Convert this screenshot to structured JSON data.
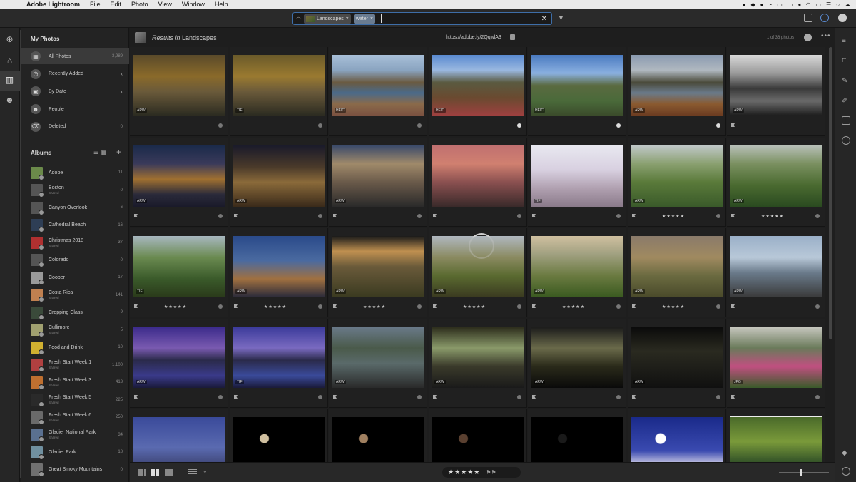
{
  "menubar": {
    "app": "Adobe Lightroom",
    "items": [
      "File",
      "Edit",
      "Photo",
      "View",
      "Window",
      "Help"
    ]
  },
  "search": {
    "chip_album": "Landscapes",
    "chip_keyword": "water"
  },
  "left_panel": {
    "my_photos_title": "My Photos",
    "nav": [
      {
        "label": "All Photos",
        "count": "3,989",
        "icon": "grid-icon"
      },
      {
        "label": "Recently Added",
        "count": "",
        "icon": "clock-icon"
      },
      {
        "label": "By Date",
        "count": "",
        "icon": "calendar-icon"
      },
      {
        "label": "People",
        "count": "",
        "icon": "person-icon"
      },
      {
        "label": "Deleted",
        "count": "0",
        "icon": "trash-icon"
      }
    ],
    "albums_title": "Albums",
    "albums": [
      {
        "name": "Adobe",
        "sub": "",
        "count": "11",
        "color": "#6b8a4a"
      },
      {
        "name": "Boston",
        "sub": "Shared",
        "count": "0",
        "color": "#555555"
      },
      {
        "name": "Canyon Overlook",
        "sub": "",
        "count": "6",
        "color": "#555555"
      },
      {
        "name": "Cathedral Beach",
        "sub": "",
        "count": "16",
        "color": "#2e3e55"
      },
      {
        "name": "Christmas 2018",
        "sub": "Shared",
        "count": "37",
        "color": "#b03030"
      },
      {
        "name": "Colorado",
        "sub": "",
        "count": "0",
        "color": "#555555"
      },
      {
        "name": "Cooper",
        "sub": "",
        "count": "17",
        "color": "#9a9a9a"
      },
      {
        "name": "Costa Rica",
        "sub": "Shared",
        "count": "141",
        "color": "#c08050"
      },
      {
        "name": "Cropping Class",
        "sub": "",
        "count": "9",
        "color": "#3a4a3a"
      },
      {
        "name": "Cullimore",
        "sub": "Shared",
        "count": "5",
        "color": "#a0a070"
      },
      {
        "name": "Food and Drink",
        "sub": "",
        "count": "10",
        "color": "#d0b030"
      },
      {
        "name": "Fresh Start Week 1",
        "sub": "Shared",
        "count": "1,100",
        "color": "#b04040"
      },
      {
        "name": "Fresh Start Week 3",
        "sub": "Shared",
        "count": "413",
        "color": "#c07030"
      },
      {
        "name": "Fresh Start Week 5",
        "sub": "Shared",
        "count": "225",
        "color": "#2a2a2a"
      },
      {
        "name": "Fresh Start Week 6",
        "sub": "Shared",
        "count": "250",
        "color": "#6a6a6a"
      },
      {
        "name": "Glacier National Park",
        "sub": "Shared",
        "count": "34",
        "color": "#5a7090"
      },
      {
        "name": "Glacier Park",
        "sub": "",
        "count": "18",
        "color": "#7090a0"
      },
      {
        "name": "Great Smoky Mountains",
        "sub": "",
        "count": "0",
        "color": "#707070"
      }
    ]
  },
  "header": {
    "results_prefix": "Results in",
    "results_album": "Landscapes",
    "share_link": "https://adobe.ly/2QqwlA3",
    "photo_count": "1 of 36 photos"
  },
  "grid": {
    "photos": [
      {
        "badge": "ARW",
        "stars": "",
        "status": "dot",
        "flag": false,
        "bg": "linear-gradient(180deg,#5a4a2a 0%,#8a6a2a 35%,#6a5a3a 60%,#2a2a20 100%)"
      },
      {
        "badge": "TIF",
        "stars": "",
        "status": "dot",
        "flag": false,
        "bg": "linear-gradient(180deg,#6a5a2a 0%,#9a7a30 35%,#6a5a3a 60%,#2a2a20 100%)"
      },
      {
        "badge": "HEIC",
        "stars": "",
        "status": "dot",
        "flag": false,
        "bg": "linear-gradient(180deg,#a8bfd8 0%,#8aa4c0 25%,#6a5a40 45%,#4a6a8a 62%,#8a6a4a 80%,#7a5040 100%)"
      },
      {
        "badge": "HEIC",
        "stars": "",
        "status": "check",
        "flag": false,
        "bg": "linear-gradient(180deg,#5a8ad0 0%,#9ab8e0 25%,#5a5a40 45%,#6a4a30 70%,#a04040 100%)"
      },
      {
        "badge": "HEIC",
        "stars": "",
        "status": "check",
        "flag": false,
        "bg": "linear-gradient(180deg,#4a7ac0 0%,#8ab0e0 30%,#5a6a40 50%,#4a6a3a 75%,#3a4a2a 100%)"
      },
      {
        "badge": "ARW",
        "stars": "",
        "status": "check",
        "flag": false,
        "bg": "linear-gradient(180deg,#8a9ab0 0%,#b0b8c0 25%,#4a4a3a 45%,#6a7a8a 62%,#8a5a30 80%,#6a3a20 100%)"
      },
      {
        "badge": "ARW",
        "stars": "",
        "status": "",
        "flag": true,
        "bg": "linear-gradient(180deg,#d8d8d8 0%,#9a9a9a 30%,#3a3a3a 55%,#6a6a6a 75%,#1a1a1a 100%)"
      },
      {
        "badge": "ARW",
        "stars": "",
        "status": "dot",
        "flag": true,
        "bg": "linear-gradient(180deg,#1a2a4a 0%,#3a3a5a 30%,#a07030 55%,#2a2a3a 80%,#1a1a2a 100%)"
      },
      {
        "badge": "ARW",
        "stars": "",
        "status": "dot",
        "flag": true,
        "bg": "linear-gradient(180deg,#1a1a2a 0%,#4a3a2a 35%,#8a6a3a 60%,#3a2a1a 100%)"
      },
      {
        "badge": "ARW",
        "stars": "",
        "status": "dot",
        "flag": true,
        "bg": "linear-gradient(180deg,#3a4a6a 0%,#a08a6a 30%,#6a5a4a 60%,#2a2a2a 100%)"
      },
      {
        "badge": "",
        "stars": "",
        "status": "dot",
        "flag": true,
        "bg": "linear-gradient(180deg,#c07070 0%,#d08070 30%,#8a5050 60%,#3a2a2a 100%)"
      },
      {
        "badge": "TIF",
        "stars": "",
        "status": "dot",
        "flag": true,
        "bg": "linear-gradient(180deg,#e8e8f0 0%,#d8d0e0 40%,#b0a0b0 70%,#8a7a8a 100%)"
      },
      {
        "badge": "ARW",
        "stars": "★★★★★",
        "status": "dot",
        "flag": true,
        "bg": "linear-gradient(180deg,#c0c8c8 0%,#8aa070 30%,#5a7a3a 60%,#3a5a2a 100%)"
      },
      {
        "badge": "ARW",
        "stars": "★★★★★",
        "status": "dot",
        "flag": true,
        "bg": "linear-gradient(180deg,#b8c0b8 0%,#7a9060 30%,#4a6a30 65%,#2a4a20 100%)"
      },
      {
        "badge": "TIF",
        "stars": "★★★★★",
        "status": "dot",
        "flag": true,
        "bg": "linear-gradient(180deg,#a8b8c0 0%,#6a8a50 35%,#3a5a2a 70%,#2a3a1a 100%)"
      },
      {
        "badge": "ARW",
        "stars": "★★★★★",
        "status": "dot",
        "flag": true,
        "bg": "linear-gradient(180deg,#2a4a8a 0%,#4a6aa0 40%,#a07040 70%,#2a2a3a 100%)"
      },
      {
        "badge": "ARW",
        "stars": "★★★★★",
        "status": "dot",
        "flag": true,
        "bg": "linear-gradient(180deg,#1a1a1a 0%,#c09050 25%,#6a5a3a 50%,#3a3a20 100%)"
      },
      {
        "badge": "ARW",
        "stars": "★★★★★",
        "status": "dot",
        "flag": true,
        "bg": "linear-gradient(180deg,#b0b8c0 0%,#8a8a60 35%,#5a6a30 65%,#3a3a20 100%)"
      },
      {
        "badge": "ARW",
        "stars": "★★★★★",
        "status": "dot",
        "flag": true,
        "bg": "linear-gradient(180deg,#d0c0a0 0%,#a0a080 30%,#6a7a40 65%,#3a5a20 100%)"
      },
      {
        "badge": "ARW",
        "stars": "★★★★★",
        "status": "dot",
        "flag": true,
        "bg": "linear-gradient(180deg,#8a7a6a 0%,#a08a60 35%,#6a6a40 65%,#4a4a2a 100%)"
      },
      {
        "badge": "ARW",
        "stars": "",
        "status": "dot",
        "flag": true,
        "bg": "linear-gradient(180deg,#9ab0c8 0%,#b8c8d8 35%,#6a7a8a 60%,#3a3a3a 100%)"
      },
      {
        "badge": "ARW",
        "stars": "",
        "status": "dot",
        "flag": true,
        "bg": "linear-gradient(180deg,#3a2a8a 0%,#7a5ab0 35%,#2a2a4a 55%,#3a3a8a 80%,#1a1a3a 100%)"
      },
      {
        "badge": "TIF",
        "stars": "",
        "status": "dot",
        "flag": true,
        "bg": "linear-gradient(180deg,#3a3a9a 0%,#7a6ac0 35%,#2a2a4a 55%,#3a4a9a 80%,#1a1a3a 100%)"
      },
      {
        "badge": "ARW",
        "stars": "",
        "status": "dot",
        "flag": true,
        "bg": "linear-gradient(180deg,#6a7a8a 0%,#4a5a4a 35%,#5a6a6a 60%,#2a2a2a 100%)"
      },
      {
        "badge": "ARW",
        "stars": "",
        "status": "dot",
        "flag": true,
        "bg": "linear-gradient(180deg,#2a2a1a 0%,#8a9a6a 35%,#3a3a2a 65%,#1a1a1a 100%)"
      },
      {
        "badge": "ARW",
        "stars": "",
        "status": "dot",
        "flag": true,
        "bg": "linear-gradient(180deg,#1a1a1a 0%,#6a6a4a 35%,#2a2a1a 65%,#0a0a0a 100%)"
      },
      {
        "badge": "ARW",
        "stars": "",
        "status": "dot",
        "flag": true,
        "bg": "linear-gradient(180deg,#0a0a0a 0%,#2a2a20 40%,#101010 100%)"
      },
      {
        "badge": "JPG",
        "stars": "",
        "status": "dot",
        "flag": true,
        "bg": "linear-gradient(180deg,#c8c8c0 0%,#6a7a5a 35%,#c05080 65%,#3a5a2a 100%)"
      },
      {
        "badge": "",
        "stars": "",
        "status": "",
        "flag": false,
        "bg": "linear-gradient(180deg,#3a4a9a 0%,#5a6ab0 50%,#2a2a4a 100%)"
      },
      {
        "badge": "",
        "stars": "",
        "status": "",
        "flag": false,
        "bg": "radial-gradient(circle at 34% 35%, #d0c0a0 0 6px, #000 7px)"
      },
      {
        "badge": "",
        "stars": "",
        "status": "",
        "flag": false,
        "bg": "radial-gradient(circle at 34% 35%, #a08060 0 6px, #000 7px)"
      },
      {
        "badge": "",
        "stars": "",
        "status": "",
        "flag": false,
        "bg": "radial-gradient(circle at 34% 35%, #5a4030 0 6px, #000 7px)"
      },
      {
        "badge": "",
        "stars": "",
        "status": "",
        "flag": false,
        "bg": "radial-gradient(circle at 34% 35%, #1a1a1a 0 6px, #000 7px)"
      },
      {
        "badge": "",
        "stars": "",
        "status": "",
        "flag": false,
        "bg": "radial-gradient(circle at 32% 35%, #ffffff 0 7px, transparent 8px), linear-gradient(180deg,#1a2a8a 0%,#3a4ab0 55%,#c0c0e0 75%,#8a8ab0 100%)"
      },
      {
        "badge": "",
        "stars": "",
        "status": "",
        "flag": false,
        "selected": true,
        "bg": "linear-gradient(180deg,#4a6a2a 0%,#7a9a3a 40%,#3a5a2a 70%,#1a2a1a 100%)"
      }
    ]
  },
  "bottombar": {
    "rating_stars": "★★★★★"
  }
}
